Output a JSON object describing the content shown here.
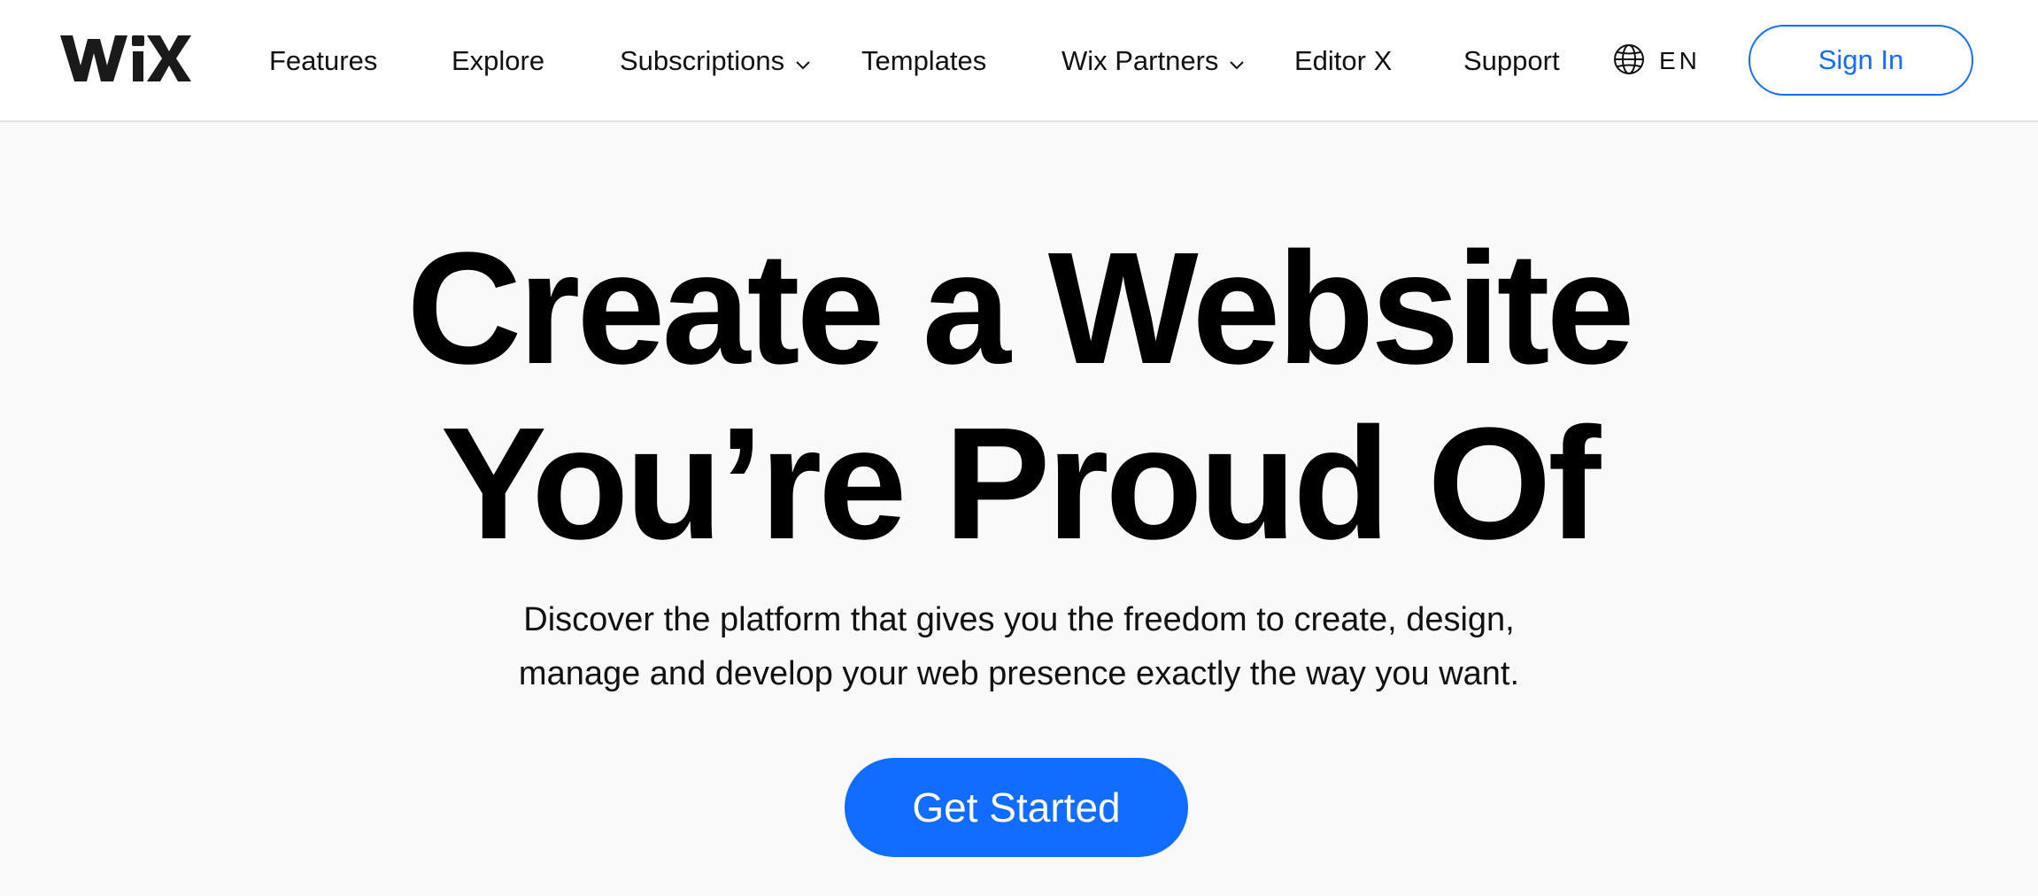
{
  "brand": {
    "logo_text": "WiX",
    "accent_color": "#116dff"
  },
  "nav": {
    "items": [
      {
        "label": "Features",
        "has_dropdown": false
      },
      {
        "label": "Explore",
        "has_dropdown": false
      },
      {
        "label": "Subscriptions",
        "has_dropdown": true
      },
      {
        "label": "Templates",
        "has_dropdown": false
      },
      {
        "label": "Wix Partners",
        "has_dropdown": true
      },
      {
        "label": "Editor X",
        "has_dropdown": false
      },
      {
        "label": "Support",
        "has_dropdown": false
      }
    ],
    "language": {
      "icon": "globe-icon",
      "label": "EN"
    },
    "sign_in_label": "Sign In"
  },
  "hero": {
    "title_line1": "Create a Website",
    "title_line2": "You’re Proud Of",
    "subtitle_line1": "Discover the platform that gives you the freedom to create, design,",
    "subtitle_line2": "manage and develop your web presence exactly the way you want.",
    "cta_label": "Get Started"
  }
}
